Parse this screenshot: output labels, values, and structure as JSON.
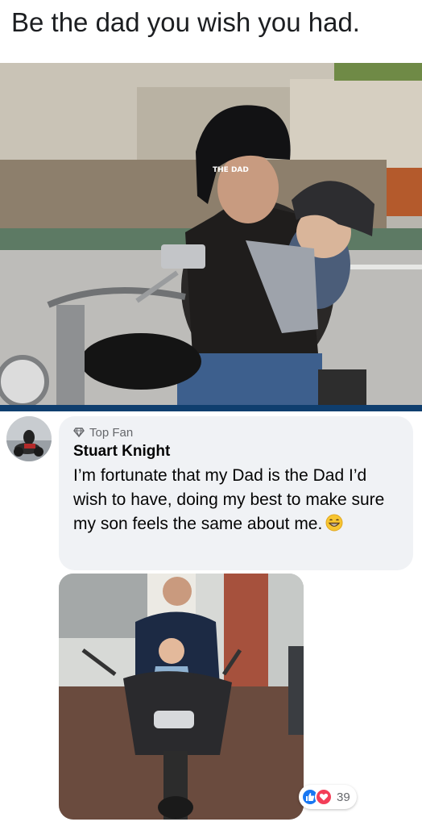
{
  "post": {
    "caption": "Be the dad you wish you had.",
    "helmet_text": "THE DAD"
  },
  "comment": {
    "badge_icon": "top-fan-gem-icon",
    "badge_label": "Top Fan",
    "author": "Stuart Knight",
    "text": "I’m fortunate that my Dad is the Dad I’d wish to have, doing my best to make sure my son feels the same about me.",
    "emoji": "grinning-face-icon"
  },
  "reactions": {
    "icons": [
      "like-icon",
      "love-icon"
    ],
    "count": "39"
  },
  "colors": {
    "bubble": "#f0f2f5",
    "like": "#1877f2",
    "love": "#f33e58",
    "divider": "#0f3e6e"
  }
}
